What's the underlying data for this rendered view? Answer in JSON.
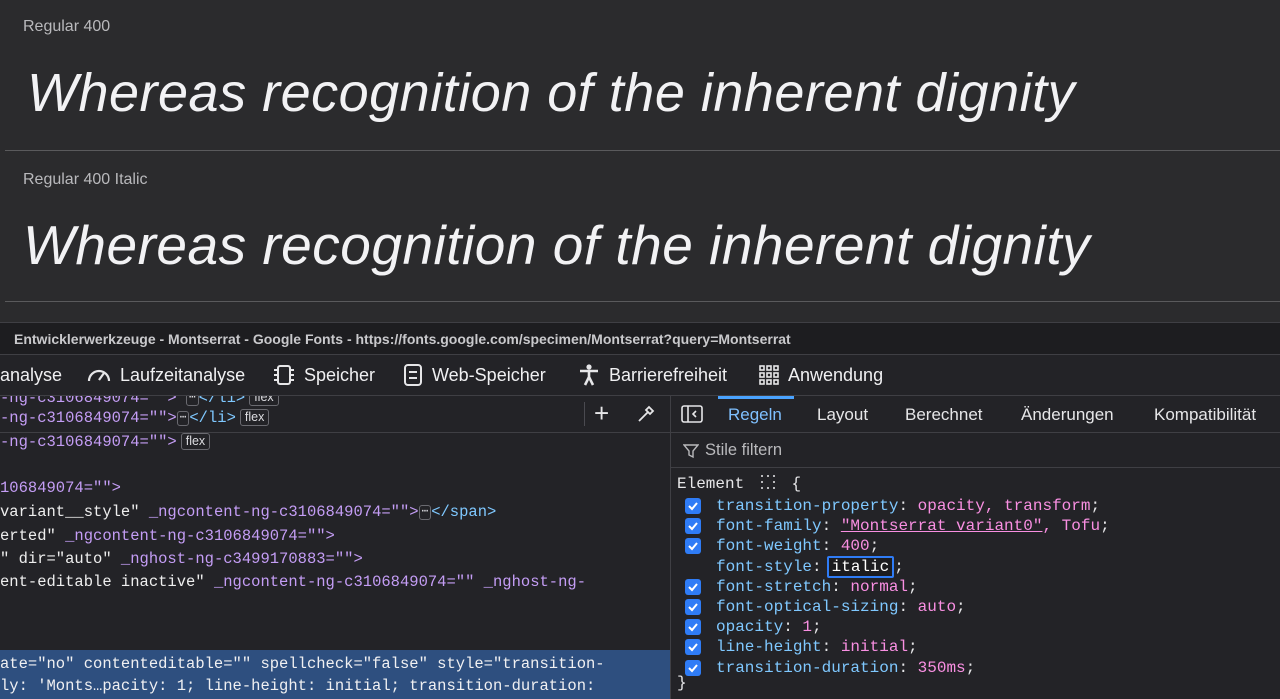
{
  "specimen": {
    "rows": [
      {
        "label": "Regular 400",
        "text": "Whereas recognition of the inherent dignity"
      },
      {
        "label": "Regular 400 Italic",
        "text": "Whereas recognition of the inherent dignity"
      }
    ]
  },
  "devtools": {
    "window_title": "Entwicklerwerkzeuge - Montserrat - Google Fonts - https://fonts.google.com/specimen/Montserrat?query=Montserrat",
    "toolbar": {
      "partial_tab": "analyse",
      "runtime": "Laufzeitanalyse",
      "storage": "Speicher",
      "web_storage": "Web-Speicher",
      "accessibility": "Barrierefreiheit",
      "application": "Anwendung"
    },
    "inspector": {
      "lines": [
        {
          "a": "-ng-c3106849074=\"\">",
          "b": "</li>",
          "badge": "flex"
        },
        {
          "a": "-ng-c3106849074=\"\">",
          "b": "</li>",
          "badge": "flex"
        },
        {
          "a": "-ng-c3106849074=\"\">",
          "badge": "flex"
        },
        {
          "a": "106849074=\"\">"
        },
        {
          "a": " variant__style\"",
          "b": " _ngcontent-ng-c3106849074=\"\">",
          "c": "</span>"
        },
        {
          "a": "erted\"",
          "b": " _ngcontent-ng-c3106849074=\"\">"
        },
        {
          "a": "\" dir=\"auto\"",
          "b": " _nghost-ng-c3499170883=\"\">"
        },
        {
          "a": "ent-editable inactive\"",
          "b": " _ngcontent-ng-c3106849074=\"\" _nghost-ng-"
        },
        {
          "a": "ate=\"no\" contenteditable=\"\" spellcheck=\"false\" style=\"transition-"
        },
        {
          "a": "ly: 'Monts…pacity: 1; line-height: initial; transition-duration:"
        }
      ]
    },
    "rules": {
      "tabs": [
        "Regeln",
        "Layout",
        "Berechnet",
        "Änderungen",
        "Kompatibilität"
      ],
      "filter_placeholder": "Stile filtern",
      "selector": "Element",
      "open_brace": "{",
      "close_brace": "}",
      "declarations": [
        {
          "prop": "transition-property",
          "value": "opacity, transform",
          "checked": true
        },
        {
          "prop": "font-family",
          "value_part1": "\"Montserrat variant0\"",
          "value_part2": ", Tofu",
          "checked": true
        },
        {
          "prop": "font-weight",
          "value": "400",
          "checked": true
        },
        {
          "prop": "font-style",
          "value": "italic",
          "checked": false,
          "editing": true
        },
        {
          "prop": "font-stretch",
          "value": "normal",
          "checked": true
        },
        {
          "prop": "font-optical-sizing",
          "value": "auto",
          "checked": true
        },
        {
          "prop": "opacity",
          "value": "1",
          "checked": true
        },
        {
          "prop": "line-height",
          "value": "initial",
          "checked": true
        },
        {
          "prop": "transition-duration",
          "value": "350ms",
          "checked": true
        }
      ]
    }
  }
}
